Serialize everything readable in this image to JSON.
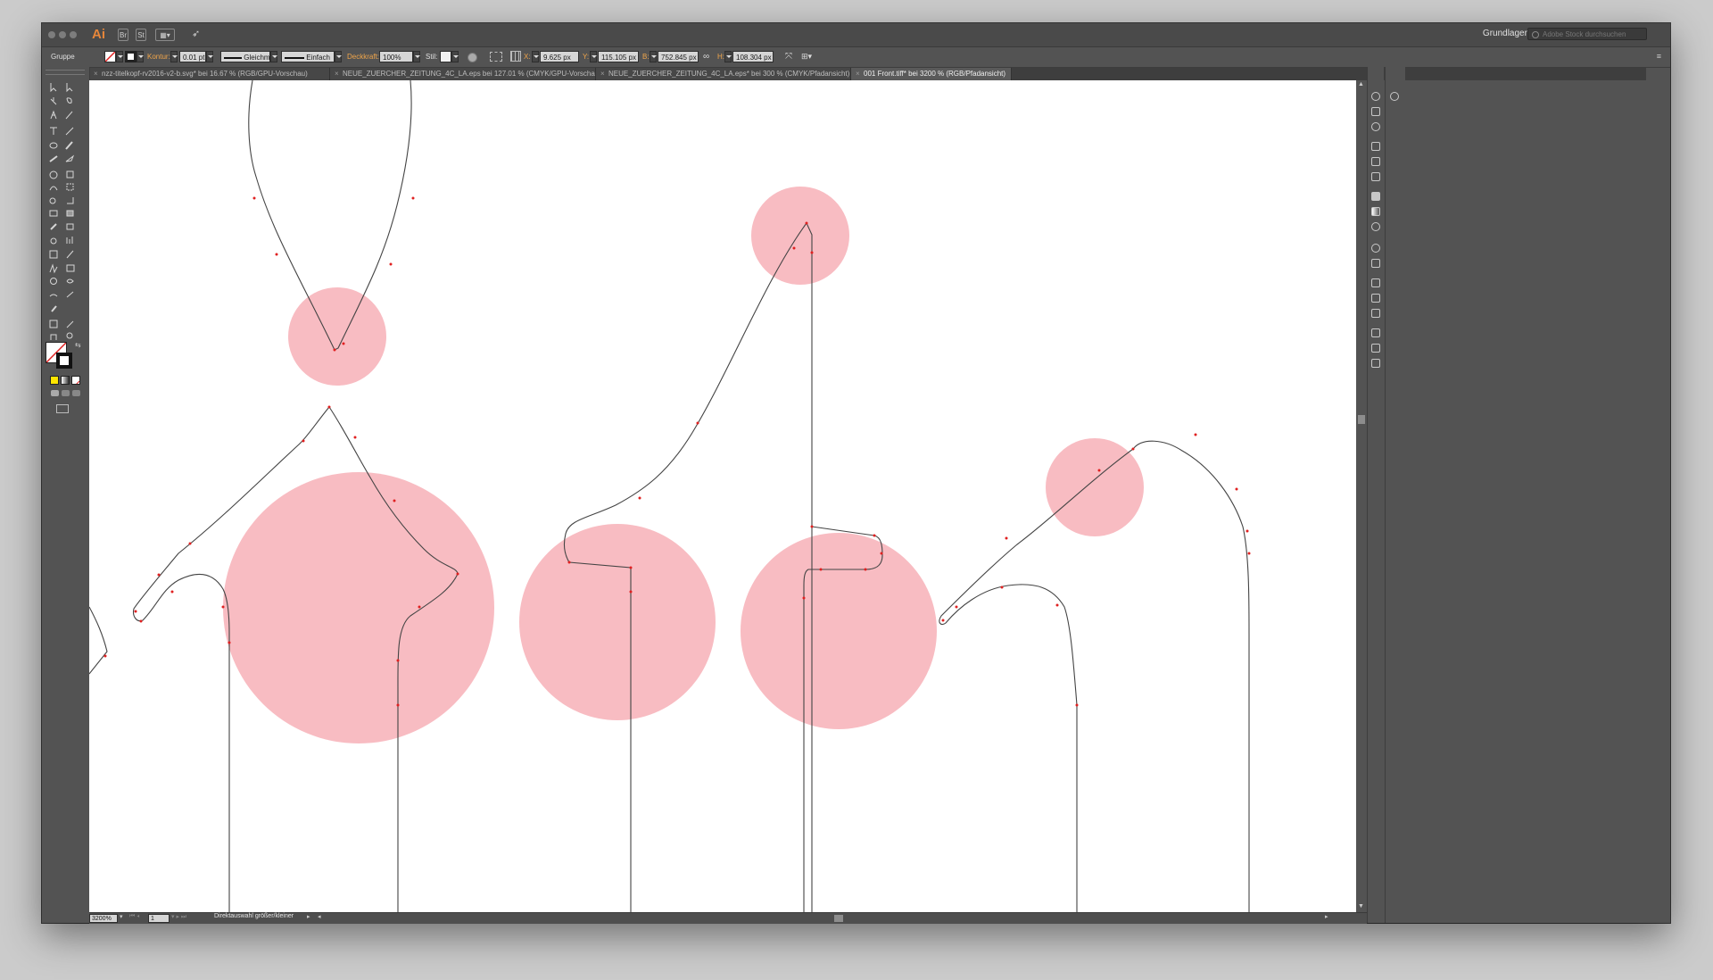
{
  "app": {
    "logo": "Ai",
    "workspace": "Grundlagen",
    "stock_search_placeholder": "Adobe Stock durchsuchen"
  },
  "control_bar": {
    "selection_label": "Gruppe",
    "stroke_label": "Kontur:",
    "stroke_value": "0.01 pt",
    "profile_value": "Gleichm.",
    "brush_value": "Einfach",
    "opacity_label": "Deckkraft:",
    "opacity_value": "100%",
    "style_label": "Stil:",
    "x_label": "X:",
    "x_value": "9.625 px",
    "y_label": "Y:",
    "y_value": "115.105 px",
    "w_label": "B:",
    "w_value": "752.845 px",
    "h_label": "H:",
    "h_value": "108.304 px"
  },
  "tabs": [
    {
      "label": "nzz-titelkopf-rv2016-v2-b.svg* bei 16.67 % (RGB/GPU-Vorschau)"
    },
    {
      "label": "NEUE_ZUERCHER_ZEITUNG_4C_LA.eps bei 127.01 % (CMYK/GPU-Vorschau)"
    },
    {
      "label": "NEUE_ZUERCHER_ZEITUNG_4C_LA.eps* bei 300 % (CMYK/Pfadansicht)"
    },
    {
      "label": "001 Front.tiff* bei 3200 % (RGB/Pfadansicht)"
    }
  ],
  "status": {
    "zoom": "3200%",
    "artboard": "1",
    "tool_info": "Direktauswahl größer/kleiner"
  },
  "colors": {
    "ui_dark": "#535353",
    "ui_darker": "#3e3e3e",
    "accent_orange": "#e6863a",
    "circle_fill": "#f8bcc2",
    "path_stroke": "#444444",
    "anchor": "#e02020"
  }
}
